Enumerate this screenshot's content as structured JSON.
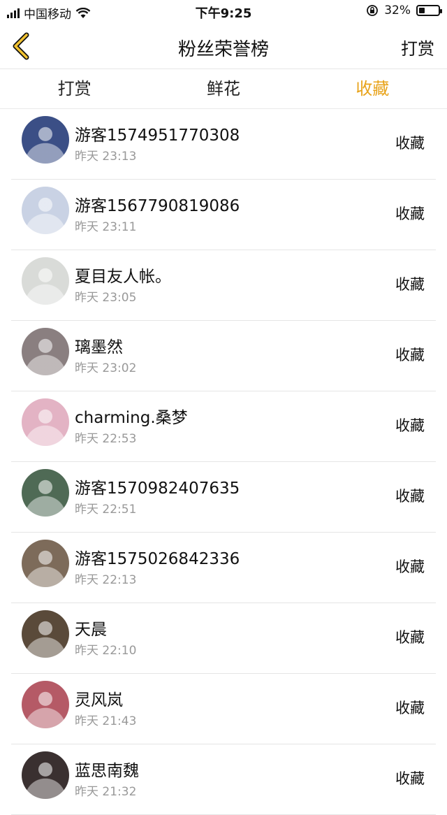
{
  "status": {
    "carrier": "中国移动",
    "time": "下午9:25",
    "battery_pct": "32%",
    "battery_level": 0.32,
    "icons": [
      "signal-icon",
      "wifi-icon",
      "orientation-lock-icon",
      "battery-icon"
    ]
  },
  "nav": {
    "back_icon": "chevron-left-icon",
    "title": "粉丝荣誉榜",
    "action": "打赏",
    "accent": "#e8a31a"
  },
  "tabs": [
    {
      "label": "打赏",
      "active": false
    },
    {
      "label": "鲜花",
      "active": false
    },
    {
      "label": "收藏",
      "active": true
    }
  ],
  "rows": [
    {
      "name": "游客1574951770308",
      "time": "昨天 23:13",
      "action": "收藏",
      "avatar": "#3b4f86"
    },
    {
      "name": "游客1567790819086",
      "time": "昨天 23:11",
      "action": "收藏",
      "avatar": "#c9d2e4"
    },
    {
      "name": "夏目友人帐。",
      "time": "昨天 23:05",
      "action": "收藏",
      "avatar": "#d9dbd8"
    },
    {
      "name": "璃墨然",
      "time": "昨天 23:02",
      "action": "收藏",
      "avatar": "#8a7f80"
    },
    {
      "name": "charming.桑梦",
      "time": "昨天 22:53",
      "action": "收藏",
      "avatar": "#e3b3c4"
    },
    {
      "name": "游客1570982407635",
      "time": "昨天 22:51",
      "action": "收藏",
      "avatar": "#4f6a55"
    },
    {
      "name": "游客1575026842336",
      "time": "昨天 22:13",
      "action": "收藏",
      "avatar": "#7d6b5a"
    },
    {
      "name": "天晨",
      "time": "昨天 22:10",
      "action": "收藏",
      "avatar": "#5a4a3a"
    },
    {
      "name": "灵风岚",
      "time": "昨天 21:43",
      "action": "收藏",
      "avatar": "#b55a66"
    },
    {
      "name": "蓝思南魏",
      "time": "昨天 21:32",
      "action": "收藏",
      "avatar": "#3a3030"
    }
  ]
}
